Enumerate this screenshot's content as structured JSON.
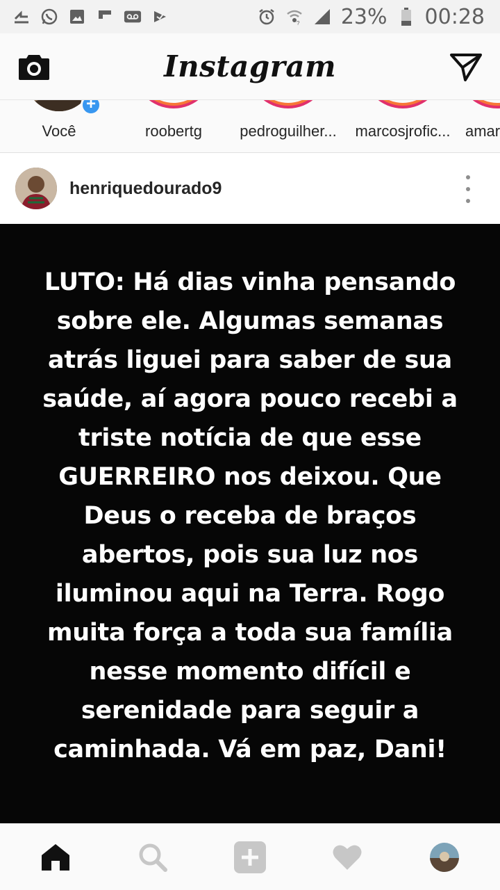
{
  "status_bar": {
    "left_icons": [
      "download-icon",
      "whatsapp-icon",
      "image-icon",
      "flipboard-icon",
      "voicemail-icon",
      "app-icon"
    ],
    "battery": "23%",
    "time": "00:28"
  },
  "app_bar": {
    "title": "Instagram",
    "camera_icon": "camera-icon",
    "direct_icon": "paper-plane-icon"
  },
  "stories": [
    {
      "label": "Você"
    },
    {
      "label": "roobertg"
    },
    {
      "label": "pedroguilher..."
    },
    {
      "label": "marcosjrofic..."
    },
    {
      "label": "amar"
    }
  ],
  "post": {
    "username": "henriquedourado9",
    "lines": [
      "LUTO: Há dias vinha pensando",
      "sobre ele. Algumas semanas",
      "atrás liguei para saber de sua",
      "saúde, aí agora pouco recebi a",
      "triste notícia de que esse",
      "GUERREIRO nos deixou. Que",
      "Deus o receba de braços",
      "abertos, pois sua luz nos",
      "iluminou aqui na Terra. Rogo",
      "muita força a toda sua família",
      "nesse momento difícil e",
      "serenidade para seguir a",
      "caminhada. Vá em paz, Dani!"
    ]
  },
  "bottom_nav": [
    "home-icon",
    "search-icon",
    "add-post-icon",
    "heart-icon",
    "profile-avatar"
  ]
}
